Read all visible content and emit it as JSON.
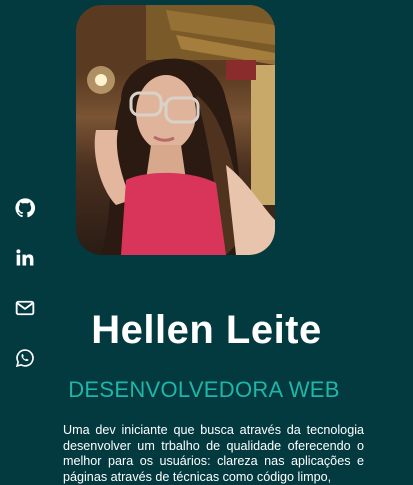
{
  "profile": {
    "name": "Hellen Leite",
    "role": "DESENVOLVEDORA WEB",
    "bio": "Uma dev iniciante que busca através da tecnologia desenvolver um trbalho de qualidade oferecendo o melhor para os usuários: clareza nas aplicações e páginas através de técnicas como código limpo,"
  },
  "social": [
    {
      "icon": "github-icon"
    },
    {
      "icon": "linkedin-icon"
    },
    {
      "icon": "mail-icon"
    },
    {
      "icon": "whatsapp-icon"
    }
  ],
  "colors": {
    "background": "#033a40",
    "accent": "#1fb6a8",
    "text": "#ffffff"
  }
}
